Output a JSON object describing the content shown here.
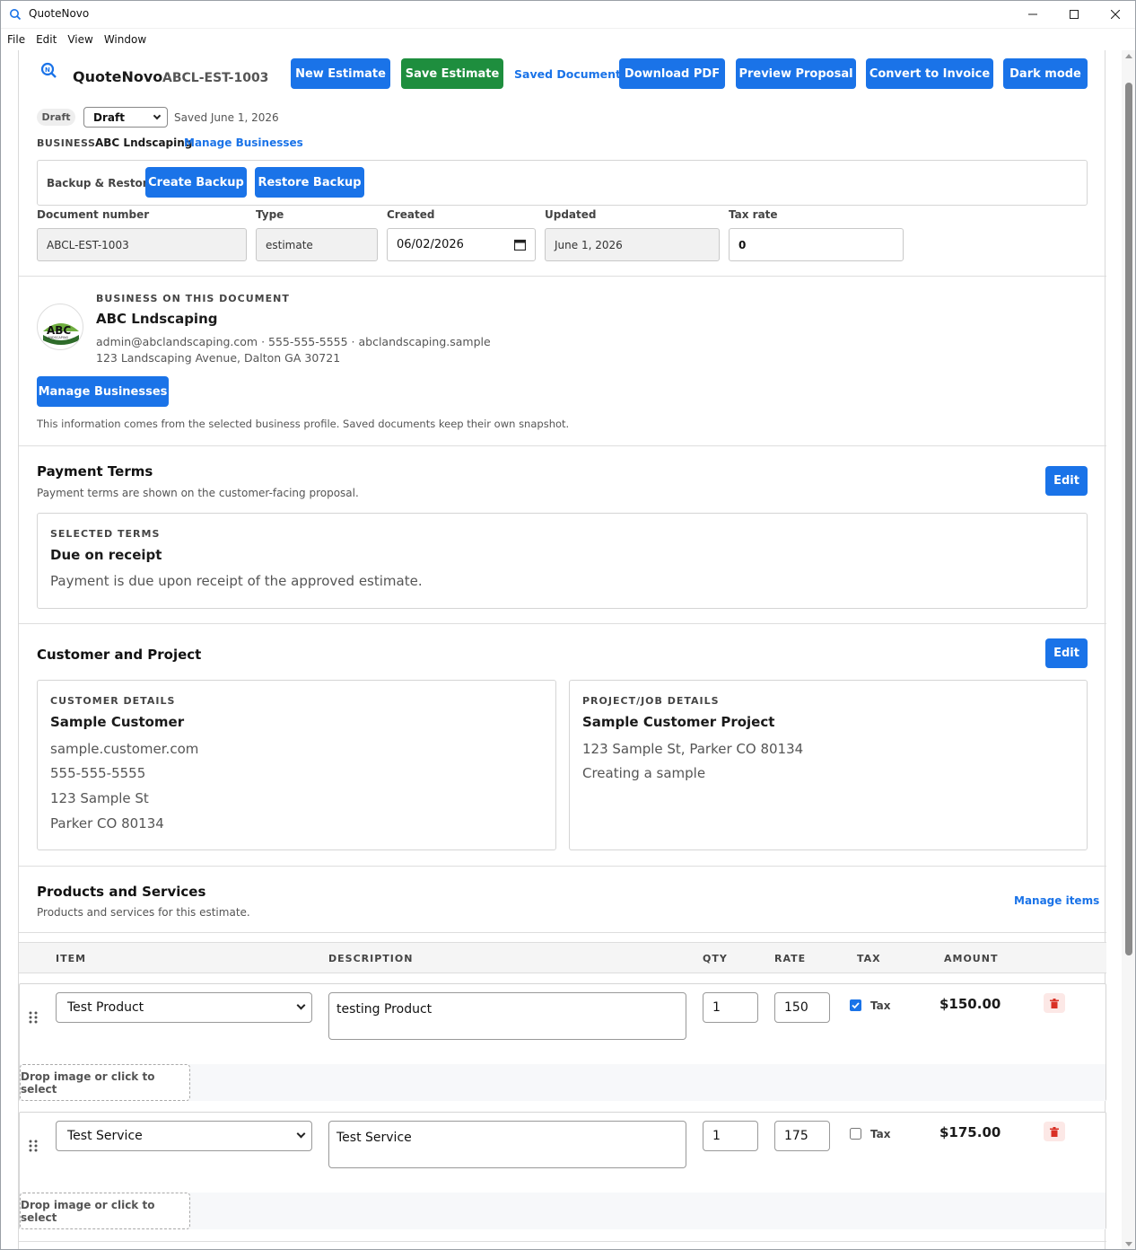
{
  "window": {
    "title": "QuoteNovo"
  },
  "menu": [
    "File",
    "Edit",
    "View",
    "Window"
  ],
  "header": {
    "app_name": "QuoteNovo",
    "doc_number": "ABCL-EST-1003",
    "buttons": {
      "new_estimate": "New Estimate",
      "save_estimate": "Save Estimate",
      "saved_documents": "Saved Documents",
      "download_pdf": "Download PDF",
      "preview_proposal": "Preview Proposal",
      "convert_invoice": "Convert to Invoice",
      "dark_mode": "Dark mode"
    },
    "status_badge": "Draft",
    "status_select": "Draft",
    "saved_text": "Saved June 1, 2026",
    "business_label": "BUSINESS",
    "business_name": "ABC Lndscaping",
    "manage_businesses_link": "Manage Businesses"
  },
  "backup": {
    "label": "Backup & Restore",
    "create": "Create Backup",
    "restore": "Restore Backup"
  },
  "meta": {
    "doc_number_label": "Document number",
    "doc_number_value": "ABCL-EST-1003",
    "type_label": "Type",
    "type_value": "estimate",
    "created_label": "Created",
    "created_value": "06/02/2026",
    "updated_label": "Updated",
    "updated_value": "June 1, 2026",
    "tax_label": "Tax rate",
    "tax_value": "0"
  },
  "business_section": {
    "heading": "BUSINESS ON THIS DOCUMENT",
    "name": "ABC Lndscaping",
    "contact": "admin@abclandscaping.com · 555-555-5555 · abclandscaping.sample",
    "address": "123 Landscaping Avenue, Dalton GA 30721",
    "logo_text": "ABC",
    "logo_sub": "LANDSCAPING",
    "manage_button": "Manage Businesses",
    "note": "This information comes from the selected business profile. Saved documents keep their own snapshot."
  },
  "payment": {
    "title": "Payment Terms",
    "subtitle": "Payment terms are shown on the customer-facing proposal.",
    "edit": "Edit",
    "selected_label": "SELECTED TERMS",
    "term": "Due on receipt",
    "description": "Payment is due upon receipt of the approved estimate."
  },
  "customer": {
    "title": "Customer and Project",
    "edit": "Edit",
    "customer_label": "CUSTOMER DETAILS",
    "customer_name": "Sample Customer",
    "lines": [
      "sample.customer.com",
      "555-555-5555",
      "123 Sample St",
      "Parker CO 80134"
    ],
    "project_label": "PROJECT/JOB DETAILS",
    "project_name": "Sample Customer Project",
    "project_lines": [
      "123 Sample St, Parker CO 80134",
      "Creating a sample"
    ]
  },
  "products": {
    "title": "Products and Services",
    "subtitle": "Products and services for this estimate.",
    "manage_link": "Manage items",
    "columns": {
      "item": "ITEM",
      "description": "DESCRIPTION",
      "qty": "QTY",
      "rate": "RATE",
      "tax": "TAX",
      "amount": "AMOUNT"
    },
    "rows": [
      {
        "item": "Test Product",
        "description": "testing Product",
        "qty": "1",
        "rate": "150",
        "tax_label": "Tax",
        "taxed": true,
        "amount": "$150.00",
        "drop": "Drop image or click to select"
      },
      {
        "item": "Test Service",
        "description": "Test Service",
        "qty": "1",
        "rate": "175",
        "tax_label": "Tax",
        "taxed": false,
        "amount": "$175.00",
        "drop": "Drop image or click to select"
      }
    ]
  },
  "colors": {
    "primary": "#1a73e8",
    "success": "#1e8e3e",
    "danger": "#d93025"
  }
}
